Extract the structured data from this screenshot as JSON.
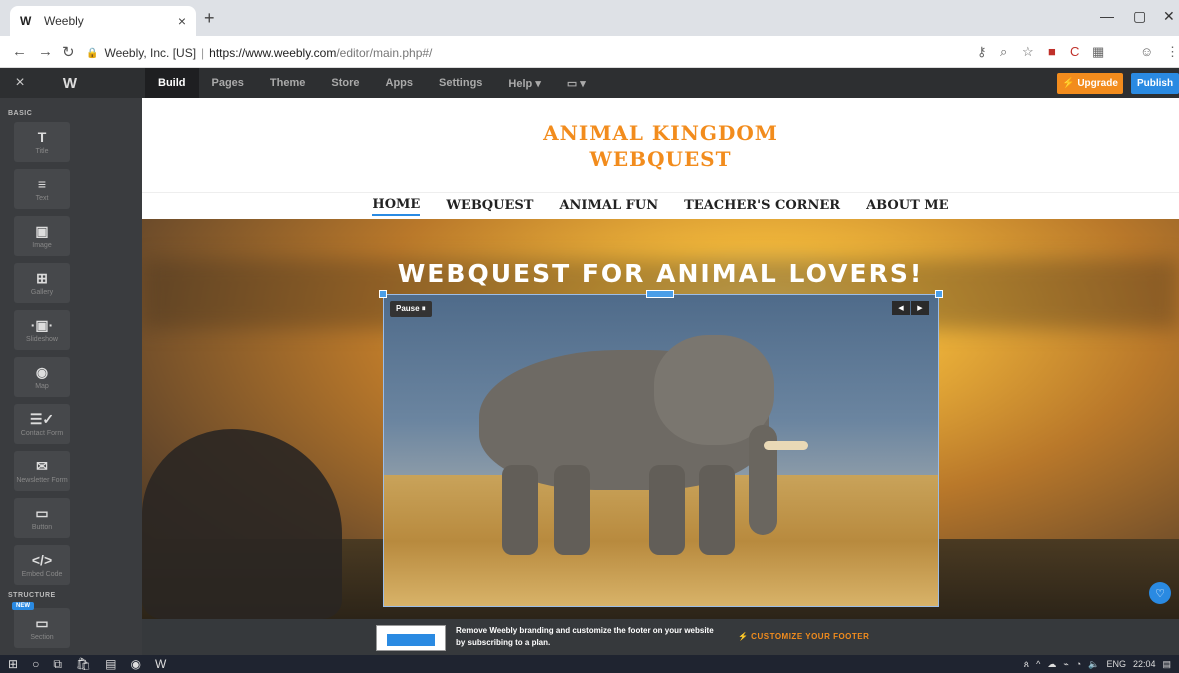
{
  "browser": {
    "tab_icon": "W",
    "tab_title": "Weebly",
    "tab_close": "×",
    "new_tab": "+",
    "org": "Weebly, Inc. [US]",
    "separator": "|",
    "url_host": "https://www.weebly.com",
    "url_path": "/editor/main.php#/"
  },
  "editor": {
    "close": "×",
    "logo": "W",
    "tabs": [
      "Build",
      "Pages",
      "Theme",
      "Store",
      "Apps",
      "Settings",
      "Help ▾",
      "▭ ▾"
    ],
    "upgrade": "⚡ Upgrade",
    "publish": "Publish"
  },
  "sidebar": {
    "basic_title": "BASIC",
    "structure_title": "STRUCTURE",
    "new_badge": "NEW",
    "elements": [
      {
        "icon": "T",
        "label": "Title"
      },
      {
        "icon": "≡",
        "label": "Text"
      },
      {
        "icon": "▣",
        "label": "Image"
      },
      {
        "icon": "⊞",
        "label": "Gallery"
      },
      {
        "icon": "·▣·",
        "label": "Slideshow"
      },
      {
        "icon": "◉",
        "label": "Map"
      },
      {
        "icon": "☰✓",
        "label": "Contact Form"
      },
      {
        "icon": "✉",
        "label": "Newsletter Form"
      },
      {
        "icon": "▭",
        "label": "Button"
      },
      {
        "icon": "</>",
        "label": "Embed Code"
      }
    ],
    "section": {
      "icon": "▭",
      "label": "Section"
    }
  },
  "site": {
    "title_line1": "ANIMAL KINGDOM",
    "title_line2": "WEBQUEST",
    "nav": [
      "HOME",
      "WEBQUEST",
      "ANIMAL FUN",
      "TEACHER'S CORNER",
      "ABOUT ME"
    ],
    "hero_title": "WEBQUEST FOR ANIMAL LOVERS!",
    "pause_label": "Pause ⏸",
    "prev": "◀",
    "next": "▶"
  },
  "footer": {
    "text": "Remove Weebly branding and customize the footer on your website by subscribing to a plan.",
    "cta": "⚡ CUSTOMIZE YOUR FOOTER"
  },
  "taskbar": {
    "lang": "ENG",
    "time": "22:04"
  },
  "colors": {
    "accent": "#f28c1d",
    "publish_blue": "#2a8ae2"
  }
}
